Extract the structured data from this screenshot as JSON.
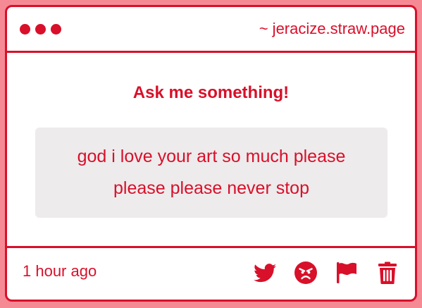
{
  "window": {
    "site_label": "~ jeracize.straw.page"
  },
  "main": {
    "heading": "Ask me something!",
    "question": "god i love your art so much please please please never stop"
  },
  "footer": {
    "time_ago": "1 hour ago",
    "actions": [
      {
        "icon": "twitter-icon"
      },
      {
        "icon": "angry-face-icon"
      },
      {
        "icon": "flag-icon"
      },
      {
        "icon": "trash-icon"
      }
    ]
  },
  "colors": {
    "accent": "#d8102a",
    "background": "#f58a95",
    "card": "#ffffff",
    "question_bg": "#edebec"
  }
}
